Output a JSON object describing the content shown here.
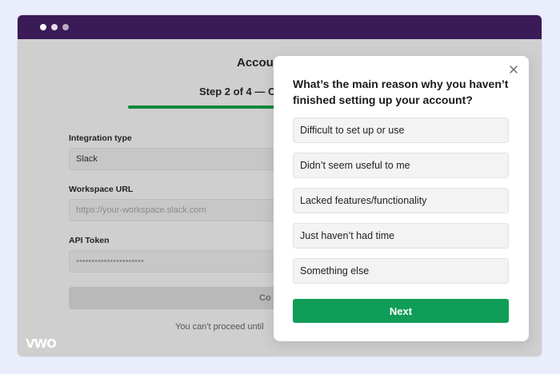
{
  "background_page": {
    "title": "Accou",
    "step": "Step 2 of 4 — C",
    "fields": [
      {
        "label": "Integration type",
        "value": "Slack"
      },
      {
        "label": "Workspace URL",
        "placeholder": "https://your-workspace.slack.com"
      },
      {
        "label": "API Token",
        "value": "••••••••••••••••••••••"
      }
    ],
    "submit_label": "Co",
    "note": "You can't proceed until"
  },
  "survey": {
    "question": "What’s the main reason why you haven’t finished setting up your account?",
    "options": [
      "Difficult to set up or use",
      "Didn’t seem useful to me",
      "Lacked features/functionality",
      "Just haven’t had time",
      "Something else"
    ],
    "next_label": "Next"
  },
  "brand": {
    "logo_text": "VWO"
  },
  "colors": {
    "titlebar": "#3a1a57",
    "primary_button": "#0f9d58",
    "progress": "#12883d"
  }
}
